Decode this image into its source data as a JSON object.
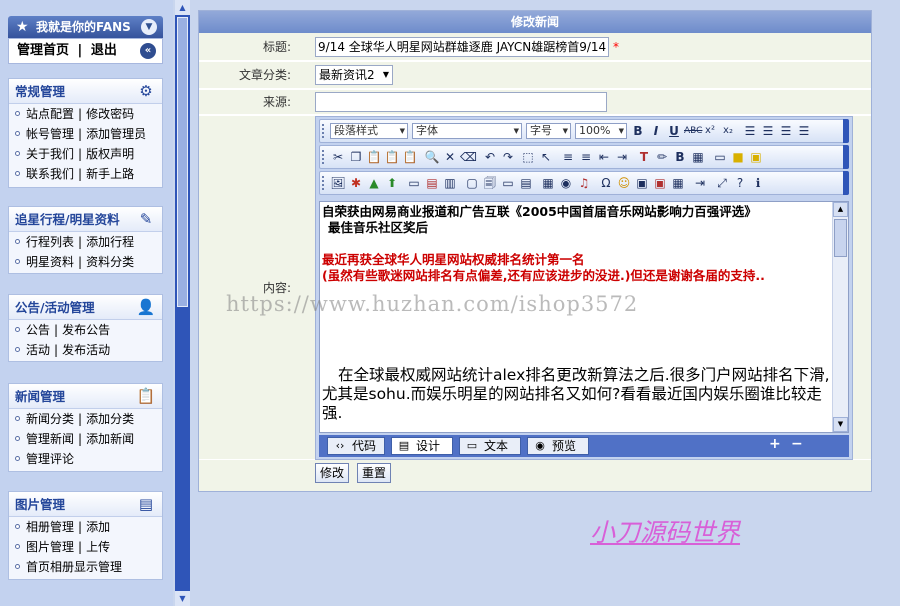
{
  "sidebar": {
    "header": "我就是你的FANS",
    "links": {
      "home": "管理首页",
      "sep": "|",
      "logout": "退出"
    },
    "sections": [
      {
        "title": "常规管理",
        "icon": "gear-icon",
        "rows": [
          [
            "站点配置",
            "修改密码"
          ],
          [
            "帐号管理",
            "添加管理员"
          ],
          [
            "关于我们",
            "版权声明"
          ],
          [
            "联系我们",
            "新手上路"
          ]
        ]
      },
      {
        "title": "追星行程/明星资料",
        "icon": "edit-icon",
        "rows": [
          [
            "行程列表",
            "添加行程"
          ],
          [
            "明星资料",
            "资料分类"
          ]
        ]
      },
      {
        "title": "公告/活动管理",
        "icon": "user-icon",
        "rows": [
          [
            "公告",
            "发布公告"
          ],
          [
            "活动",
            "发布活动"
          ]
        ]
      },
      {
        "title": "新闻管理",
        "icon": "note-icon",
        "rows": [
          [
            "新闻分类",
            "添加分类"
          ],
          [
            "管理新闻",
            "添加新闻"
          ],
          [
            "管理评论"
          ]
        ]
      },
      {
        "title": "图片管理",
        "icon": "picture-icon",
        "rows": [
          [
            "相册管理",
            "添加"
          ],
          [
            "图片管理",
            "上传"
          ],
          [
            "首页相册显示管理"
          ]
        ]
      }
    ],
    "row_sep": "|"
  },
  "panel": {
    "title": "修改新闻",
    "fields": {
      "title_label": "标题:",
      "title_value": "9/14 全球华人明星网站群雄逐鹿 JAYCN雄踞榜首9/14 全",
      "required_mark": "*",
      "category_label": "文章分类:",
      "category_value": "最新资讯2",
      "source_label": "来源:",
      "source_value": "",
      "content_label": "内容:"
    },
    "editor": {
      "toolbar_dropdowns": {
        "style": "段落样式",
        "font": "字体",
        "size": "字号",
        "zoom": "100%"
      },
      "content": {
        "line1": "自荣获由网易商业报道和广告互联《2005中国首届音乐网站影响力百强评选》",
        "line2": "最佳音乐社区奖后",
        "line3": "最近再获全球华人明星网站权威排名统计第一名",
        "line4": "(虽然有些歌迷网站排名有点偏差,还有应该进步的没进.)但还是谢谢各届的支持..",
        "para1": "在全球最权威网站统计alex排名更改新算法之后.很多门户网站排名下滑,",
        "para2": "尤其是sohu.而娱乐明星的网站排名又如何?看看最近国内娱乐圈谁比较走强."
      },
      "modes": [
        "代码",
        "设计",
        "文本",
        "预览"
      ],
      "zoom_in": "+",
      "zoom_out": "−"
    },
    "buttons": {
      "save": "修改",
      "reset": "重置"
    }
  },
  "watermark": "https://www.huzhan.com/ishop3572",
  "signature": "小刀源码世界"
}
